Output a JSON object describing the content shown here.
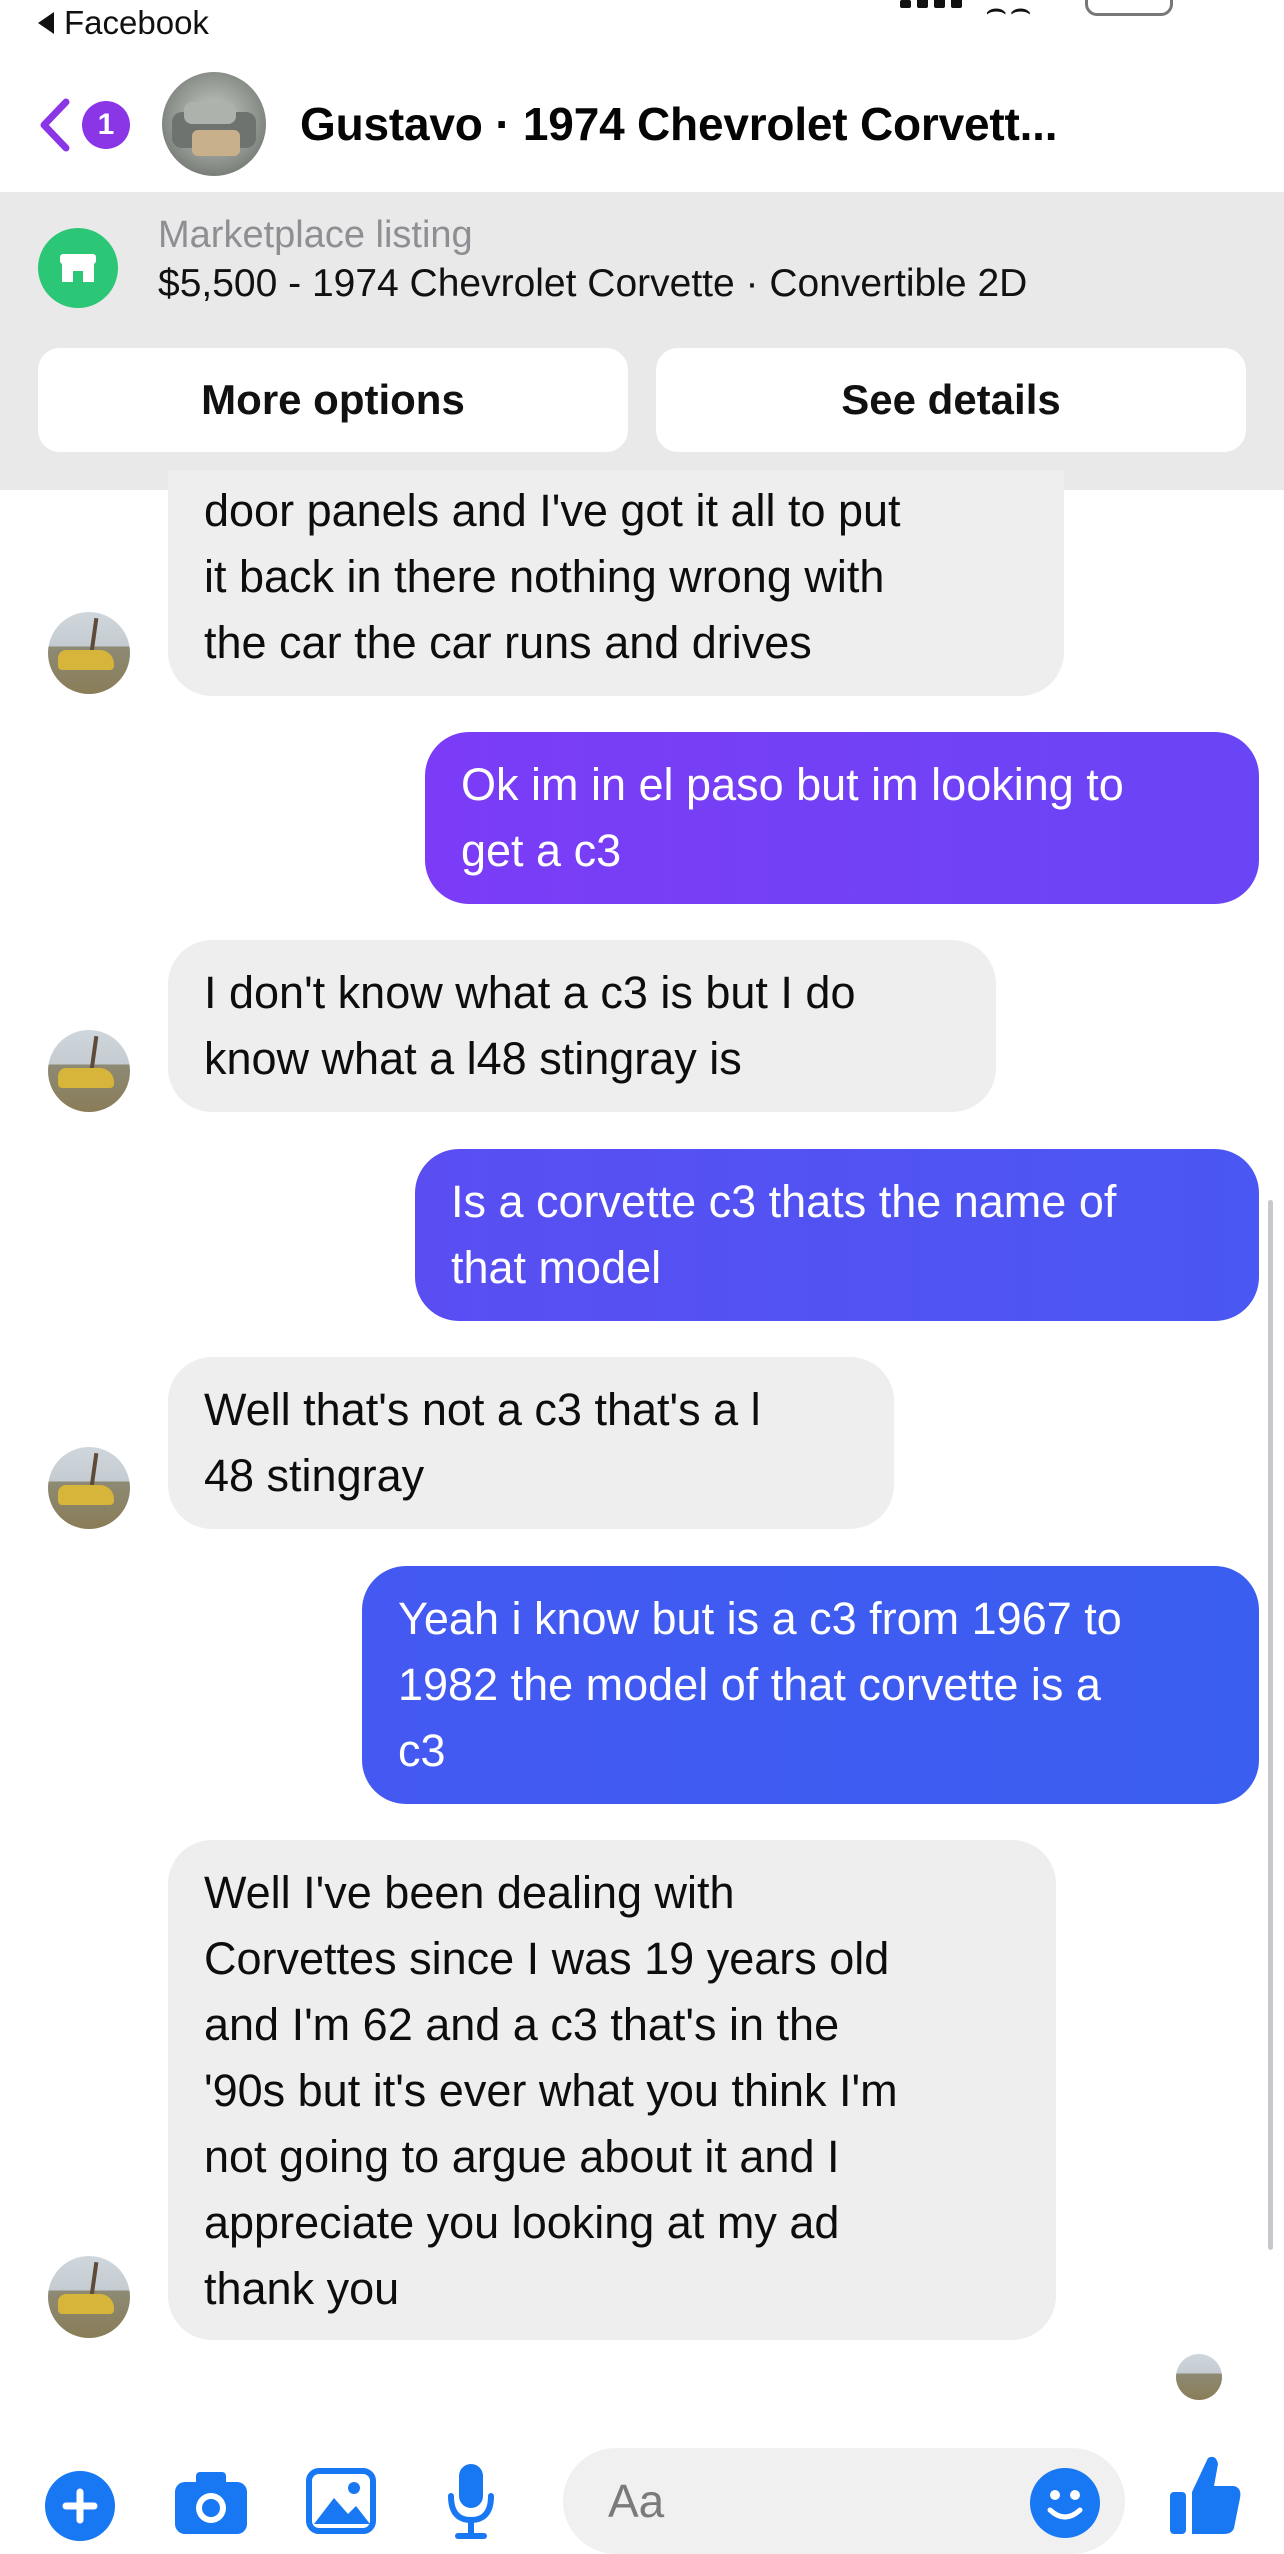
{
  "status_bar": {
    "back_app": "Facebook"
  },
  "header": {
    "unread_count": "1",
    "title": "Gustavo · 1974 Chevrolet Corvett..."
  },
  "listing": {
    "label": "Marketplace listing",
    "title": "$5,500 - 1974 Chevrolet Corvette · Convertible 2D",
    "more_options": "More options",
    "see_details": "See details"
  },
  "messages": [
    {
      "from": "seller",
      "lines": [
        "door panels and I've got it all to put",
        "it back in there nothing wrong with",
        "the car the car runs and drives"
      ]
    },
    {
      "from": "me",
      "lines": [
        "Ok im in el paso but im looking to",
        "get a c3"
      ]
    },
    {
      "from": "seller",
      "lines": [
        "I don't know what a c3 is but I do",
        "know what a l48 stingray is"
      ]
    },
    {
      "from": "me",
      "lines": [
        "Is a corvette c3 thats the name of",
        "that model"
      ]
    },
    {
      "from": "seller",
      "lines": [
        "Well that's not a c3 that's a l",
        "48 stingray"
      ]
    },
    {
      "from": "me",
      "lines": [
        "Yeah i know but is a c3 from 1967 to",
        "1982 the model of that corvette is a",
        "c3"
      ]
    },
    {
      "from": "seller",
      "lines": [
        "Well I've been dealing with",
        "Corvettes since I was 19 years old",
        "and I'm 62 and a c3 that's in the",
        "'90s but it's ever what you think I'm",
        "not going to argue about it and I",
        "appreciate you looking at my ad",
        "thank you"
      ]
    }
  ],
  "composer": {
    "placeholder": "Aa"
  },
  "colors": {
    "accent_purple": "#8a35e6",
    "bubble_out_start": "#7b3ef6",
    "bubble_out_end": "#3c5df0",
    "bubble_in": "#eeeeef",
    "marketplace_green": "#2bc777",
    "icon_blue": "#1877f2"
  }
}
